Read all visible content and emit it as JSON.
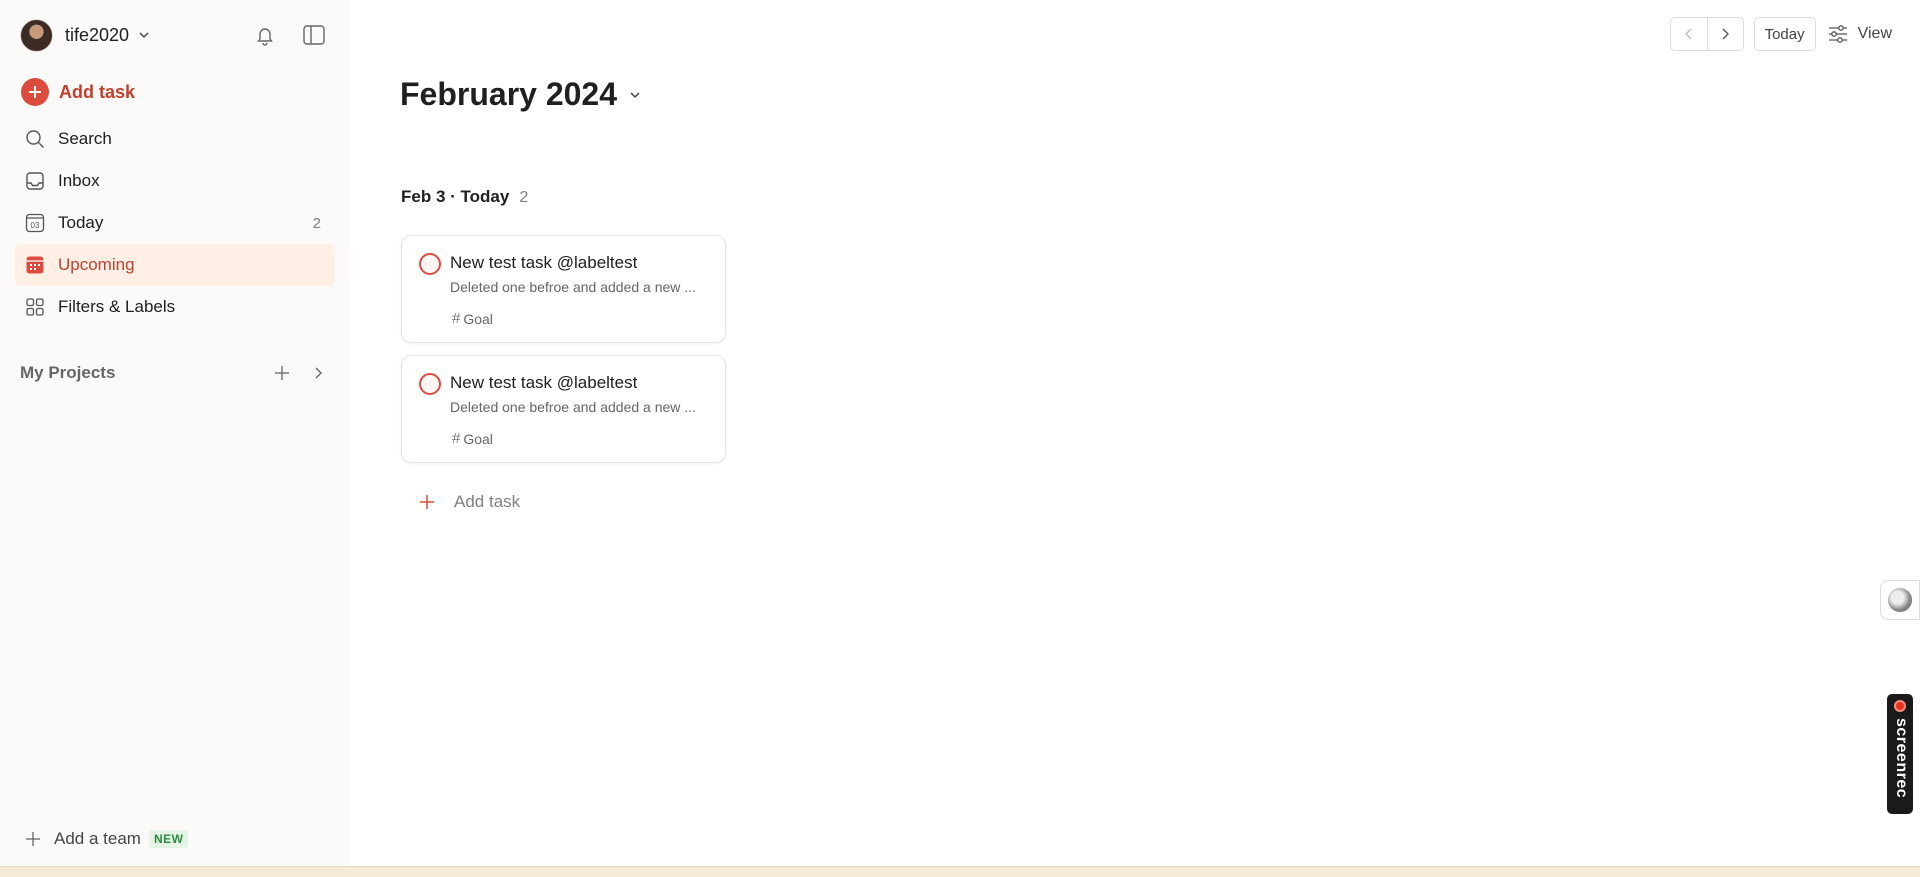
{
  "sidebar": {
    "username": "tife2020",
    "add_task_label": "Add task",
    "nav": [
      {
        "label": "Search",
        "count": ""
      },
      {
        "label": "Inbox",
        "count": ""
      },
      {
        "label": "Today",
        "count": "2"
      },
      {
        "label": "Upcoming",
        "count": ""
      },
      {
        "label": "Filters & Labels",
        "count": ""
      }
    ],
    "today_icon_text": "03",
    "projects_label": "My Projects",
    "add_team_label": "Add a team",
    "add_team_badge": "NEW"
  },
  "toolbar": {
    "today_label": "Today",
    "view_label": "View"
  },
  "main": {
    "month_title": "February 2024",
    "day_header": "Feb 3 · Today",
    "day_count": "2",
    "tasks": [
      {
        "title": "New test task @labeltest",
        "description": "Deleted one befroe and added a new ...",
        "project": "Goal"
      },
      {
        "title": "New test task @labeltest",
        "description": "Deleted one befroe and added a new ...",
        "project": "Goal"
      }
    ],
    "add_task_label": "Add task"
  },
  "overlay": {
    "screenrec_text": "screenrec"
  },
  "colors": {
    "accent": "#dc4c3e",
    "active_bg": "#ffefe5",
    "sidebar_bg": "#fcfaf8"
  }
}
